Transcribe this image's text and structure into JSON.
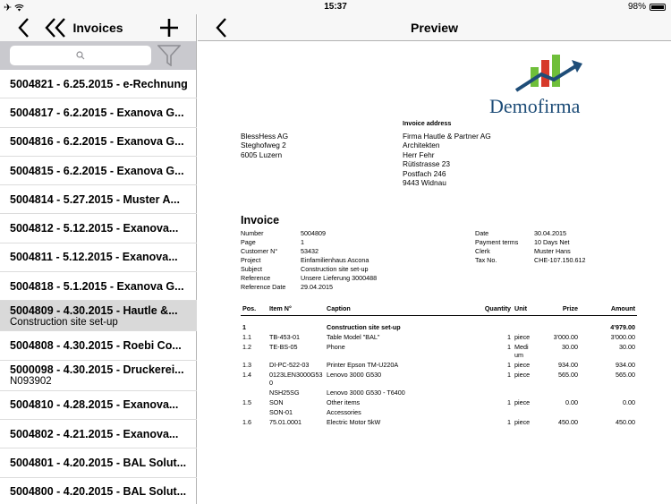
{
  "status": {
    "time": "15:37",
    "battery": "98%",
    "battery_level": 0.98,
    "left_icons": [
      "airplane-icon",
      "wifi-icon"
    ]
  },
  "master": {
    "title": "Invoices",
    "search_placeholder": "",
    "items": [
      {
        "title": "5004821 - 6.25.2015 - e-Rechnung",
        "subtitle": ""
      },
      {
        "title": "5004817 - 6.2.2015 - Exanova G...",
        "subtitle": ""
      },
      {
        "title": "5004816 - 6.2.2015 - Exanova G...",
        "subtitle": ""
      },
      {
        "title": "5004815 - 6.2.2015 - Exanova G...",
        "subtitle": ""
      },
      {
        "title": "5004814 - 5.27.2015 - Muster A...",
        "subtitle": ""
      },
      {
        "title": "5004812 - 5.12.2015 - Exanova...",
        "subtitle": ""
      },
      {
        "title": "5004811 - 5.12.2015 - Exanova...",
        "subtitle": ""
      },
      {
        "title": "5004818 - 5.1.2015 - Exanova G...",
        "subtitle": ""
      },
      {
        "title": "5004809 - 4.30.2015 - Hautle &...",
        "subtitle": "Construction site set-up",
        "selected": true
      },
      {
        "title": "5004808 - 4.30.2015 - Roebi Co...",
        "subtitle": ""
      },
      {
        "title": "5000098 - 4.30.2015 - Druckerei...",
        "subtitle": "N093902"
      },
      {
        "title": "5004810 - 4.28.2015 - Exanova...",
        "subtitle": ""
      },
      {
        "title": "5004802 - 4.21.2015 - Exanova...",
        "subtitle": ""
      },
      {
        "title": "5004801 - 4.20.2015 - BAL Solut...",
        "subtitle": ""
      },
      {
        "title": "5004800 - 4.20.2015 - BAL Solut...",
        "subtitle": ""
      }
    ]
  },
  "detail": {
    "title": "Preview",
    "doc": {
      "logo_text": "Demofirma",
      "invoice_address_label": "Invoice address",
      "sender": [
        "BlessHess AG",
        "Steghofweg 2",
        "6005 Luzern"
      ],
      "recipient": [
        "Firma Hautle & Partner AG",
        "Architekten",
        "Herr Fehr",
        "Rütistrasse 23",
        "Postfach 246",
        "9443 Widnau"
      ],
      "heading": "Invoice",
      "left_fields": [
        {
          "k": "Number",
          "v": "5004809"
        },
        {
          "k": "Page",
          "v": "1"
        },
        {
          "k": "Customer N°",
          "v": "53432"
        },
        {
          "k": "Project",
          "v": "Einfamilienhaus Ascona"
        },
        {
          "k": "Subject",
          "v": "Construction site set-up"
        },
        {
          "k": "Reference",
          "v": "Unsere Lieferung 3000488"
        },
        {
          "k": "Reference Date",
          "v": "29.04.2015"
        }
      ],
      "right_fields": [
        {
          "k": "Date",
          "v": "30.04.2015"
        },
        {
          "k": "Payment terms",
          "v": "10 Days Net"
        },
        {
          "k": "Clerk",
          "v": "Muster Hans"
        },
        {
          "k": "Tax No.",
          "v": "CHE-107.150.612"
        }
      ],
      "columns": {
        "pos": "Pos.",
        "item": "Item N°",
        "caption": "Caption",
        "qty": "Quantity",
        "unit": "Unit",
        "price": "Prize",
        "amount": "Amount"
      },
      "rows": [
        {
          "pos": "",
          "item": "",
          "caption": "",
          "qty": "",
          "unit": "",
          "price": "",
          "amount": ""
        },
        {
          "pos": "1",
          "item": "",
          "caption": "Construction site set-up",
          "qty": "",
          "unit": "",
          "price": "",
          "amount": "4'979.00",
          "bold": true
        },
        {
          "pos": "1.1",
          "item": "TB-453-01",
          "caption": "Table Model \"BAL\"",
          "qty": "1",
          "unit": "piece",
          "price": "3'000.00",
          "amount": "3'000.00"
        },
        {
          "pos": "1.2",
          "item": "TE-BS-05",
          "caption": "Phone",
          "qty": "1",
          "unit": "Medi um",
          "price": "30.00",
          "amount": "30.00"
        },
        {
          "pos": "1.3",
          "item": "DI-PC-522-03",
          "caption": "Printer Epson TM-U220A",
          "qty": "1",
          "unit": "piece",
          "price": "934.00",
          "amount": "934.00"
        },
        {
          "pos": "1.4",
          "item": "0123LEN3000G530",
          "caption": "Lenovo 3000 G530",
          "qty": "1",
          "unit": "piece",
          "price": "565.00",
          "amount": "565.00"
        },
        {
          "pos": "",
          "item": "NSH25SG",
          "caption": "Lenovo 3000 G530 - T6400",
          "qty": "",
          "unit": "",
          "price": "",
          "amount": ""
        },
        {
          "pos": "1.5",
          "item": "SON",
          "caption": "Other items",
          "qty": "1",
          "unit": "piece",
          "price": "0.00",
          "amount": "0.00"
        },
        {
          "pos": "",
          "item": "SON-01",
          "caption": "Accessories",
          "qty": "",
          "unit": "",
          "price": "",
          "amount": ""
        },
        {
          "pos": "1.6",
          "item": "75.01.0001",
          "caption": "Electric Motor 5kW",
          "qty": "1",
          "unit": "piece",
          "price": "450.00",
          "amount": "450.00"
        }
      ]
    }
  },
  "colors": {
    "logo_blue": "#1e4d78",
    "logo_green": "#6fbf3a",
    "logo_red": "#d63a2a",
    "selected_row": "#d9d9d9"
  }
}
